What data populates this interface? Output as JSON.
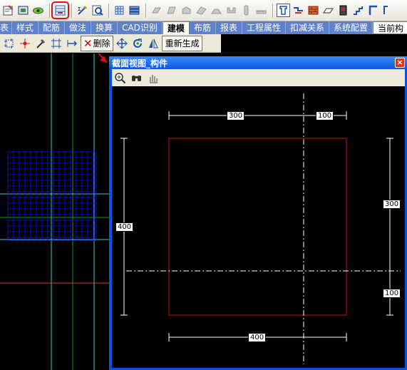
{
  "toolbar_icons": [
    "properties-icon",
    "image-icon",
    "eye-icon",
    "section-view-icon",
    "brush-icon",
    "magnifier-icon",
    "grid-icon",
    "layers-icon",
    "shape-icon",
    "shape-icon",
    "shape-icon",
    "shape-icon",
    "shape-icon",
    "shape-icon",
    "shape-icon",
    "ruler-icon",
    "column-icon",
    "wall-icon",
    "brick-icon",
    "slab-icon",
    "block-icon",
    "stair-icon",
    "corner-icon",
    "wall-edge-icon"
  ],
  "menu": {
    "tabs": [
      "表",
      "样式",
      "配筋",
      "做法",
      "换算",
      "CAD识别",
      "建模",
      "布筋",
      "报表",
      "工程属性",
      "扣减关系",
      "系统配置",
      "当前构"
    ],
    "active_tab": "建模"
  },
  "toolbar2": {
    "delete_label": "删除",
    "regenerate_label": "重新生成"
  },
  "section_window": {
    "title": "截面视图_构件",
    "close_label": "×"
  },
  "dimensions": {
    "top_left": "300",
    "top_right": "100",
    "right_upper": "300",
    "right_lower": "100",
    "left": "400",
    "bottom": "400"
  },
  "colors": {
    "menubar": "#5e81c9",
    "window_frame": "#0055e5",
    "section_outline": "#cc1111",
    "mesh": "#1010c0",
    "guide_cyan": "#2fd0d0",
    "arrow": "#e01010"
  }
}
